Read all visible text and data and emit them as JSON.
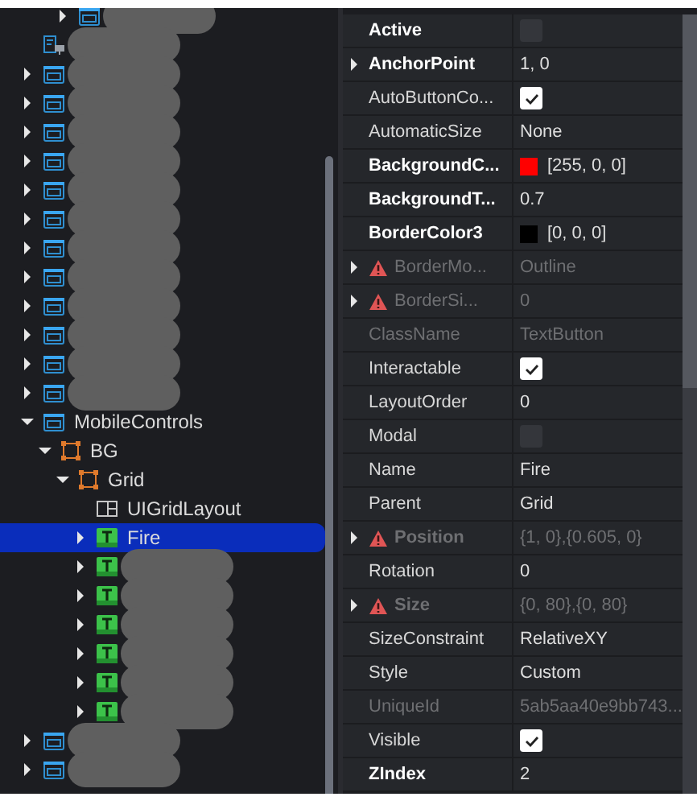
{
  "explorer": {
    "continued_items": [
      {
        "kind": "screen",
        "expanded": false,
        "redacted": true,
        "selected": false
      }
    ],
    "items": [
      {
        "kind": "layout",
        "redacted": true,
        "selected": false
      },
      {
        "kind": "screen",
        "expanded": false,
        "redacted": true,
        "selected": false
      },
      {
        "kind": "screen",
        "expanded": false,
        "redacted": true,
        "selected": false
      },
      {
        "kind": "screen",
        "expanded": false,
        "redacted": true,
        "selected": false
      },
      {
        "kind": "screen",
        "expanded": false,
        "redacted": true,
        "selected": false
      },
      {
        "kind": "screen",
        "expanded": false,
        "redacted": true,
        "selected": false
      },
      {
        "kind": "screen",
        "expanded": false,
        "redacted": true,
        "selected": false
      },
      {
        "kind": "screen",
        "expanded": false,
        "redacted": true,
        "selected": false
      },
      {
        "kind": "screen",
        "expanded": false,
        "redacted": true,
        "selected": false
      },
      {
        "kind": "screen",
        "expanded": false,
        "redacted": true,
        "selected": false
      },
      {
        "kind": "screen",
        "expanded": false,
        "redacted": true,
        "selected": false
      },
      {
        "kind": "screen",
        "expanded": false,
        "redacted": true,
        "selected": false
      },
      {
        "kind": "screen",
        "expanded": false,
        "redacted": true,
        "selected": false
      },
      {
        "kind": "screen",
        "expanded": true,
        "name": "MobileControls",
        "selected": false,
        "children": [
          {
            "kind": "frame",
            "expanded": true,
            "name": "BG",
            "selected": false,
            "children": [
              {
                "kind": "frame",
                "expanded": true,
                "name": "Grid",
                "selected": false,
                "children": [
                  {
                    "kind": "grid",
                    "name": "UIGridLayout",
                    "selected": false
                  },
                  {
                    "kind": "button",
                    "expanded": false,
                    "name": "Fire",
                    "selected": true
                  },
                  {
                    "kind": "button",
                    "expanded": false,
                    "redacted": true,
                    "selected": false
                  },
                  {
                    "kind": "button",
                    "expanded": false,
                    "redacted": true,
                    "selected": false
                  },
                  {
                    "kind": "button",
                    "expanded": false,
                    "redacted": true,
                    "selected": false
                  },
                  {
                    "kind": "button",
                    "expanded": false,
                    "redacted": true,
                    "selected": false
                  },
                  {
                    "kind": "button",
                    "expanded": false,
                    "redacted": true,
                    "selected": false
                  },
                  {
                    "kind": "button",
                    "expanded": false,
                    "redacted": true,
                    "selected": false
                  }
                ]
              }
            ]
          }
        ]
      },
      {
        "kind": "screen",
        "expanded": false,
        "redacted": true,
        "selected": false
      },
      {
        "kind": "screen",
        "expanded": false,
        "redacted": true,
        "selected": false
      }
    ]
  },
  "properties": [
    {
      "name": "Active",
      "kind": "checkbox",
      "checked": false,
      "bold": true,
      "disabled": false,
      "warning": false,
      "expandable": false
    },
    {
      "name": "AnchorPoint",
      "kind": "text",
      "value": "1, 0",
      "bold": true,
      "disabled": false,
      "warning": false,
      "expandable": true
    },
    {
      "name": "AutoButtonCo...",
      "kind": "checkbox",
      "checked": true,
      "bold": false,
      "disabled": false,
      "warning": false,
      "expandable": false
    },
    {
      "name": "AutomaticSize",
      "kind": "text",
      "value": "None",
      "bold": false,
      "disabled": false,
      "warning": false,
      "expandable": false
    },
    {
      "name": "BackgroundC...",
      "kind": "color",
      "color": "#ff0000",
      "value": "[255, 0, 0]",
      "bold": true,
      "disabled": false,
      "warning": false,
      "expandable": false
    },
    {
      "name": "BackgroundT...",
      "kind": "text",
      "value": "0.7",
      "bold": true,
      "disabled": false,
      "warning": false,
      "expandable": false
    },
    {
      "name": "BorderColor3",
      "kind": "color",
      "color": "#000000",
      "value": "[0, 0, 0]",
      "bold": true,
      "disabled": false,
      "warning": false,
      "expandable": false
    },
    {
      "name": "BorderMo...",
      "kind": "text",
      "value": "Outline",
      "bold": false,
      "disabled": true,
      "warning": true,
      "expandable": true
    },
    {
      "name": "BorderSi...",
      "kind": "text",
      "value": "0",
      "bold": false,
      "disabled": true,
      "warning": true,
      "expandable": true
    },
    {
      "name": "ClassName",
      "kind": "text",
      "value": "TextButton",
      "bold": false,
      "disabled": true,
      "warning": false,
      "expandable": false
    },
    {
      "name": "Interactable",
      "kind": "checkbox",
      "checked": true,
      "bold": false,
      "disabled": false,
      "warning": false,
      "expandable": false
    },
    {
      "name": "LayoutOrder",
      "kind": "text",
      "value": "0",
      "bold": false,
      "disabled": false,
      "warning": false,
      "expandable": false
    },
    {
      "name": "Modal",
      "kind": "checkbox",
      "checked": false,
      "bold": false,
      "disabled": false,
      "warning": false,
      "expandable": false
    },
    {
      "name": "Name",
      "kind": "text",
      "value": "Fire",
      "bold": false,
      "disabled": false,
      "warning": false,
      "expandable": false
    },
    {
      "name": "Parent",
      "kind": "text",
      "value": "Grid",
      "bold": false,
      "disabled": false,
      "warning": false,
      "expandable": false
    },
    {
      "name": "Position",
      "kind": "text",
      "value": "{1, 0},{0.605, 0}",
      "bold": true,
      "disabled": true,
      "warning": true,
      "expandable": true
    },
    {
      "name": "Rotation",
      "kind": "text",
      "value": "0",
      "bold": false,
      "disabled": false,
      "warning": false,
      "expandable": false
    },
    {
      "name": "Size",
      "kind": "text",
      "value": "{0, 80},{0, 80}",
      "bold": true,
      "disabled": true,
      "warning": true,
      "expandable": true
    },
    {
      "name": "SizeConstraint",
      "kind": "text",
      "value": "RelativeXY",
      "bold": false,
      "disabled": false,
      "warning": false,
      "expandable": false
    },
    {
      "name": "Style",
      "kind": "text",
      "value": "Custom",
      "bold": false,
      "disabled": false,
      "warning": false,
      "expandable": false
    },
    {
      "name": "UniqueId",
      "kind": "text",
      "value": "5ab5aa40e9bb743...",
      "bold": false,
      "disabled": true,
      "warning": false,
      "expandable": false
    },
    {
      "name": "Visible",
      "kind": "checkbox",
      "checked": true,
      "bold": false,
      "disabled": false,
      "warning": false,
      "expandable": false
    },
    {
      "name": "ZIndex",
      "kind": "text",
      "value": "2",
      "bold": true,
      "disabled": false,
      "warning": false,
      "expandable": false
    }
  ]
}
